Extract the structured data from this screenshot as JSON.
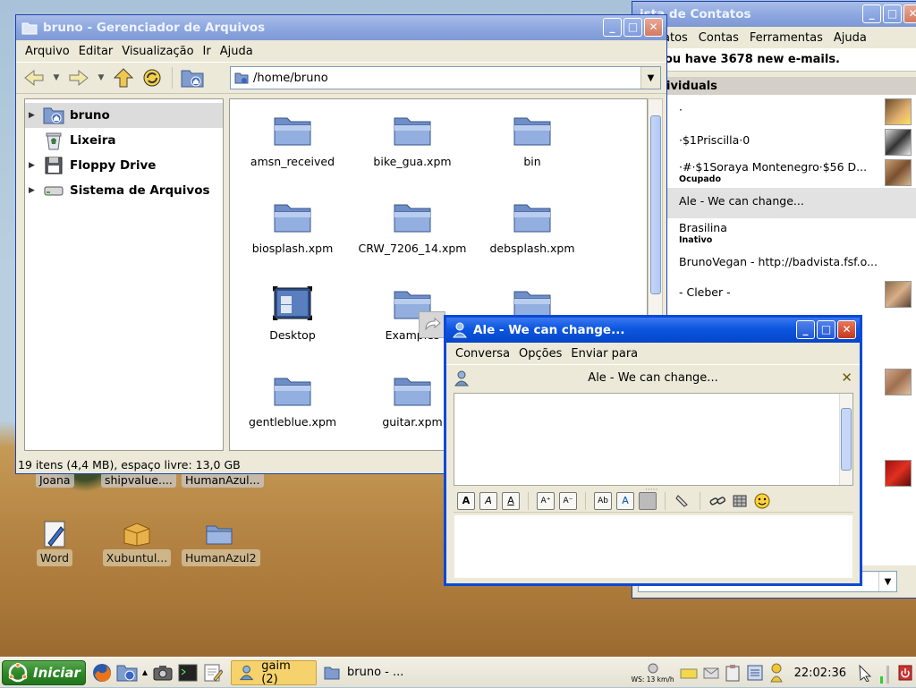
{
  "desktop": {
    "top_labels": [
      "Joana",
      "shipvalue....",
      "HumanAzul..."
    ],
    "icons": [
      {
        "label": "Word",
        "icon": "word-document-icon"
      },
      {
        "label": "Xubuntul...",
        "icon": "package-box-icon"
      },
      {
        "label": "HumanAzul2",
        "icon": "folder-icon"
      }
    ]
  },
  "file_manager": {
    "title": "bruno - Gerenciador de Arquivos",
    "menu": [
      "Arquivo",
      "Editar",
      "Visualização",
      "Ir",
      "Ajuda"
    ],
    "path": "/home/bruno",
    "sidebar": [
      {
        "label": "bruno",
        "icon": "home-folder-icon",
        "expandable": true,
        "selected": true
      },
      {
        "label": "Lixeira",
        "icon": "trash-icon",
        "expandable": false,
        "selected": false
      },
      {
        "label": "Floppy Drive",
        "icon": "floppy-icon",
        "expandable": true,
        "selected": false
      },
      {
        "label": "Sistema de Arquivos",
        "icon": "drive-icon",
        "expandable": true,
        "selected": false
      }
    ],
    "files": [
      {
        "name": "amsn_received",
        "icon": "folder-icon"
      },
      {
        "name": "bike_gua.xpm",
        "icon": "folder-icon"
      },
      {
        "name": "bin",
        "icon": "folder-icon"
      },
      {
        "name": "biosplash.xpm",
        "icon": "folder-icon"
      },
      {
        "name": "CRW_7206_14.xpm",
        "icon": "folder-icon"
      },
      {
        "name": "debsplash.xpm",
        "icon": "folder-icon"
      },
      {
        "name": "Desktop",
        "icon": "desktop-folder-icon"
      },
      {
        "name": "Examples",
        "icon": "folder-icon"
      },
      {
        "name": "gentleblue.xpm",
        "icon": "folder-icon"
      },
      {
        "name": "guitar.xpm",
        "icon": "folder-icon"
      }
    ],
    "status": "19 itens (4,4 MB), espaço livre: 13,0 GB"
  },
  "contacts": {
    "title": "Lista de Contatos",
    "title_visible": "ista de Contatos",
    "menu": [
      "atos",
      "Contas",
      "Ferramentas",
      "Ajuda"
    ],
    "banner": "ou have 3678 new e-mails.",
    "group": "ividuals",
    "items": [
      {
        "name": "·",
        "status": ""
      },
      {
        "name": "·$1Priscilla·0",
        "status": ""
      },
      {
        "name": "·#·$1Soraya  Montenegro·$56 D...",
        "status": "Ocupado"
      },
      {
        "name": "Ale - We can change...",
        "status": ""
      },
      {
        "name": "Brasilina",
        "status": "Inativo"
      },
      {
        "name": "BrunoVegan - http://badvista.fsf.o...",
        "status": ""
      },
      {
        "name": "- Cleber -",
        "status": ""
      }
    ]
  },
  "chat": {
    "title": "Ale - We can change...",
    "menu": [
      "Conversa",
      "Opções",
      "Enviar para"
    ],
    "header_name": "Ale - We can change..."
  },
  "taskbar": {
    "start_label": "Iniciar",
    "tasks": [
      {
        "label": "gaim (2)",
        "active": true
      },
      {
        "label": "bruno - ...",
        "active": false
      }
    ],
    "weather": "WS: 13 km/h",
    "clock": "22:02:36"
  }
}
